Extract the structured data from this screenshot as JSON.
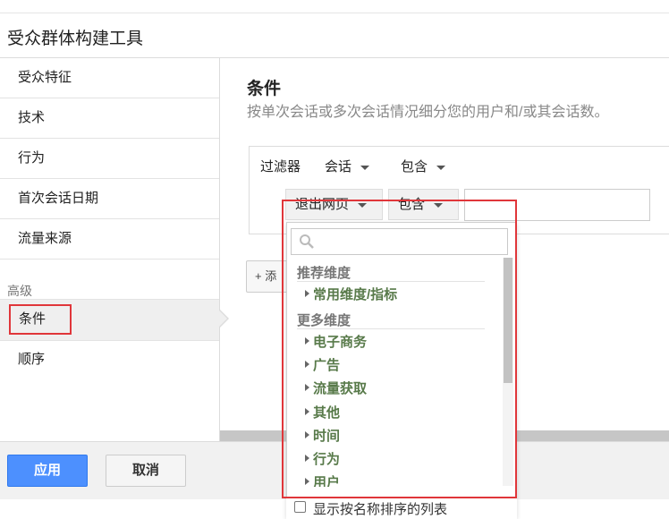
{
  "app": {
    "title": "受众群体构建工具"
  },
  "sidebar": {
    "items": [
      {
        "label": "受众特征"
      },
      {
        "label": "技术"
      },
      {
        "label": "行为"
      },
      {
        "label": "首次会话日期"
      },
      {
        "label": "流量来源"
      }
    ],
    "section_label": "高级",
    "advanced_items": [
      {
        "label": "条件"
      },
      {
        "label": "顺序"
      }
    ]
  },
  "main": {
    "title": "条件",
    "description": "按单次会话或多次会话情况细分您的用户和/或其会话数。",
    "filter": {
      "label": "过滤器",
      "scope": "会话",
      "mode": "包含",
      "dimension": "退出网页",
      "operator": "包含",
      "value": ""
    },
    "add_button": "+ 添加"
  },
  "dropdown": {
    "search_placeholder": "",
    "groups": [
      {
        "label": "推荐维度",
        "items": [
          "常用维度/指标"
        ]
      },
      {
        "label": "更多维度",
        "items": [
          "电子商务",
          "广告",
          "流量获取",
          "其他",
          "时间",
          "行为",
          "用户"
        ]
      }
    ],
    "sort_checkbox_label": "显示按名称排序的列表",
    "sort_checked": false
  },
  "footer": {
    "apply": "应用",
    "cancel": "取消"
  },
  "colors": {
    "accent": "#4d90fe",
    "highlight": "#e0363a",
    "dim_item": "#587a4a"
  }
}
